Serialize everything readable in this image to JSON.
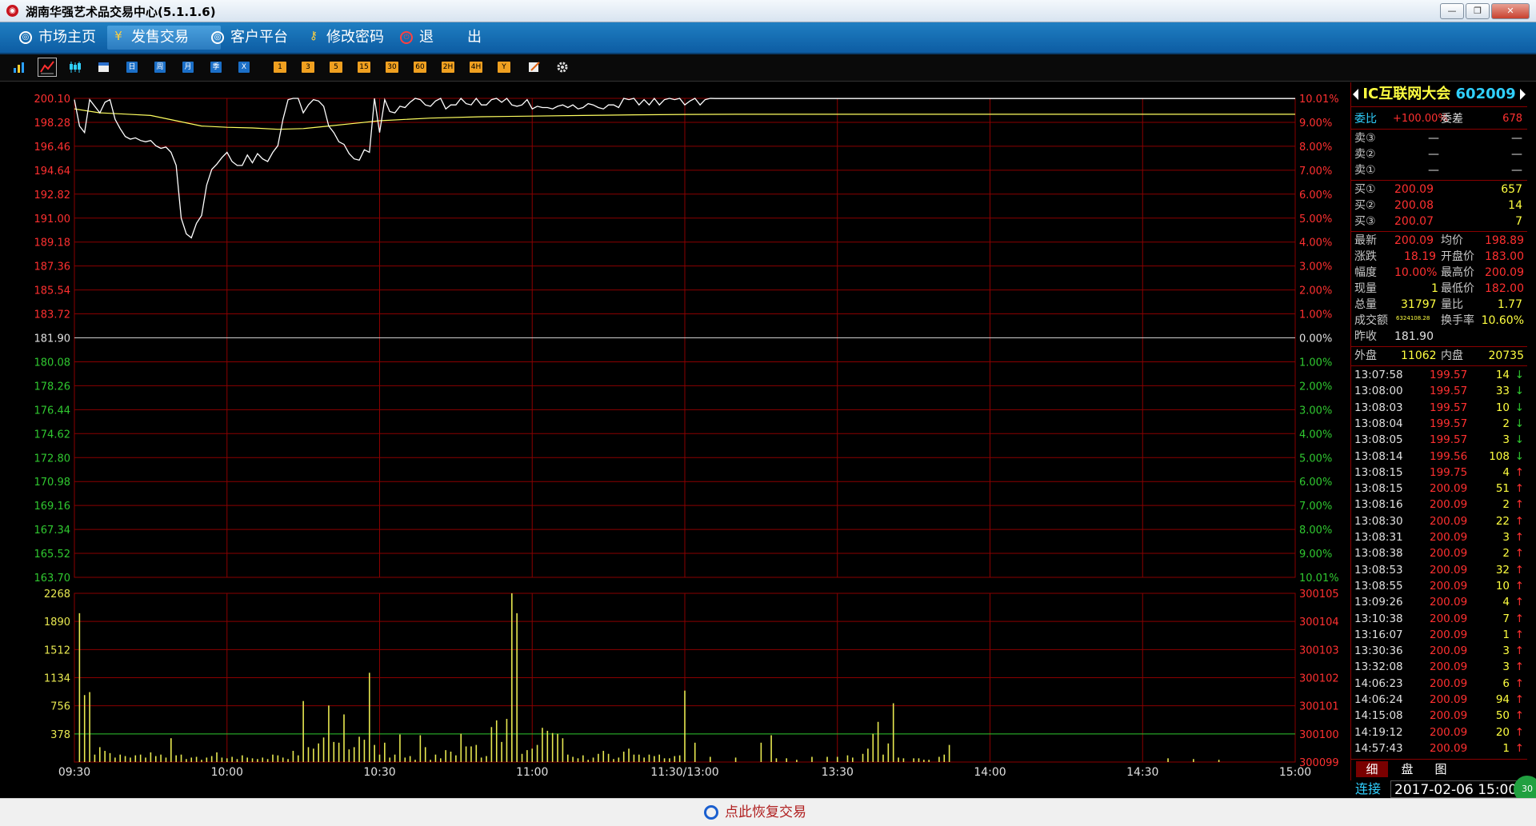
{
  "window": {
    "title": "湖南华强艺术品交易中心(5.1.1.6)",
    "min_glyph": "—",
    "max_glyph": "❐",
    "close_glyph": "✕"
  },
  "menu": [
    {
      "label": "市场主页",
      "icon": "globe-icon"
    },
    {
      "label": "发售交易",
      "icon": "yen-icon"
    },
    {
      "label": "客户平台",
      "icon": "globe-icon"
    },
    {
      "label": "修改密码",
      "icon": "key-icon"
    },
    {
      "label": "退",
      "icon": "power-icon"
    },
    {
      "label": "出",
      "icon": ""
    }
  ],
  "toolbar": {
    "icons": [
      "bar-chart-icon",
      "line-chart-icon",
      "candlestick-icon",
      "calendar-icon"
    ],
    "period_buttons": [
      "日",
      "周",
      "月",
      "季",
      "X"
    ],
    "minute_buttons": [
      "1",
      "3",
      "5",
      "15",
      "30",
      "60",
      "2H",
      "4H",
      "Y"
    ],
    "tool_icons": [
      "draw-icon",
      "gear-icon"
    ]
  },
  "chart_data": {
    "type": "line",
    "price_axis": {
      "left_labels": [
        "200.10",
        "198.28",
        "196.46",
        "194.64",
        "192.82",
        "191.00",
        "189.18",
        "187.36",
        "185.54",
        "183.72",
        "181.90",
        "180.08",
        "178.26",
        "176.44",
        "174.62",
        "172.80",
        "170.98",
        "169.16",
        "167.34",
        "165.52",
        "163.70"
      ],
      "right_labels": [
        "10.01%",
        "9.00%",
        "8.00%",
        "7.00%",
        "6.00%",
        "5.00%",
        "4.00%",
        "3.00%",
        "2.00%",
        "1.00%",
        "0.00%",
        "1.00%",
        "2.00%",
        "3.00%",
        "4.00%",
        "5.00%",
        "6.00%",
        "7.00%",
        "8.00%",
        "9.00%",
        "10.01%"
      ],
      "ylim": [
        163.7,
        200.1
      ],
      "prev_close": 181.9
    },
    "volume_axis": {
      "left_labels": [
        "2268",
        "1890",
        "1512",
        "1134",
        "756",
        "378"
      ],
      "right_labels": [
        "300105",
        "300104",
        "300103",
        "300102",
        "300101",
        "300100",
        "300099"
      ],
      "ylim": [
        0,
        2268
      ]
    },
    "time_labels": [
      "09:30",
      "10:00",
      "10:30",
      "11:00",
      "11:30/13:00",
      "13:30",
      "14:00",
      "14:30",
      "15:00"
    ],
    "x_range_minutes": 240,
    "price_series": [
      [
        0,
        200.0
      ],
      [
        1,
        198.0
      ],
      [
        2,
        197.5
      ],
      [
        3,
        200.0
      ],
      [
        4,
        199.5
      ],
      [
        5,
        199.0
      ],
      [
        6,
        199.8
      ],
      [
        7,
        200.0
      ],
      [
        8,
        198.5
      ],
      [
        9,
        197.8
      ],
      [
        10,
        197.2
      ],
      [
        11,
        197.0
      ],
      [
        12,
        197.1
      ],
      [
        13,
        196.9
      ],
      [
        14,
        196.8
      ],
      [
        15,
        196.9
      ],
      [
        16,
        196.5
      ],
      [
        17,
        196.3
      ],
      [
        18,
        196.4
      ],
      [
        19,
        196.0
      ],
      [
        20,
        195.0
      ],
      [
        21,
        191.0
      ],
      [
        22,
        189.8
      ],
      [
        23,
        189.5
      ],
      [
        24,
        190.6
      ],
      [
        25,
        191.2
      ],
      [
        26,
        193.5
      ],
      [
        27,
        194.7
      ],
      [
        28,
        195.1
      ],
      [
        29,
        195.6
      ],
      [
        30,
        196.0
      ],
      [
        31,
        195.3
      ],
      [
        32,
        195.0
      ],
      [
        33,
        195.0
      ],
      [
        34,
        195.8
      ],
      [
        35,
        195.2
      ],
      [
        36,
        195.9
      ],
      [
        37,
        195.5
      ],
      [
        38,
        195.3
      ],
      [
        39,
        196.0
      ],
      [
        40,
        196.5
      ],
      [
        41,
        198.5
      ],
      [
        42,
        200.0
      ],
      [
        43,
        200.1
      ],
      [
        44,
        200.1
      ],
      [
        45,
        199.0
      ],
      [
        46,
        199.6
      ],
      [
        47,
        200.0
      ],
      [
        48,
        199.9
      ],
      [
        49,
        199.5
      ],
      [
        50,
        198.0
      ],
      [
        51,
        197.5
      ],
      [
        52,
        196.8
      ],
      [
        53,
        196.6
      ],
      [
        54,
        195.9
      ],
      [
        55,
        195.5
      ],
      [
        56,
        195.4
      ],
      [
        57,
        196.2
      ],
      [
        58,
        196.0
      ],
      [
        59,
        200.1
      ],
      [
        60,
        197.5
      ],
      [
        61,
        200.0
      ],
      [
        62,
        199.1
      ],
      [
        63,
        199.0
      ],
      [
        64,
        199.5
      ],
      [
        65,
        199.4
      ],
      [
        66,
        199.8
      ],
      [
        67,
        200.1
      ],
      [
        68,
        200.0
      ],
      [
        69,
        199.6
      ],
      [
        70,
        199.5
      ],
      [
        71,
        199.9
      ],
      [
        72,
        200.1
      ],
      [
        73,
        199.3
      ],
      [
        74,
        199.6
      ],
      [
        75,
        199.6
      ],
      [
        76,
        200.1
      ],
      [
        77,
        199.7
      ],
      [
        78,
        199.6
      ],
      [
        79,
        200.1
      ],
      [
        80,
        199.6
      ],
      [
        81,
        199.6
      ],
      [
        82,
        200.0
      ],
      [
        83,
        200.1
      ],
      [
        84,
        199.8
      ],
      [
        85,
        200.1
      ],
      [
        86,
        199.6
      ],
      [
        87,
        199.5
      ],
      [
        88,
        199.6
      ],
      [
        89,
        200.0
      ],
      [
        90,
        199.3
      ],
      [
        91,
        199.5
      ],
      [
        92,
        199.4
      ],
      [
        93,
        199.4
      ],
      [
        94,
        199.3
      ],
      [
        95,
        199.5
      ],
      [
        96,
        199.6
      ],
      [
        97,
        199.4
      ],
      [
        98,
        199.6
      ],
      [
        99,
        199.3
      ],
      [
        100,
        199.4
      ],
      [
        101,
        199.7
      ],
      [
        102,
        199.6
      ],
      [
        103,
        199.4
      ],
      [
        104,
        199.3
      ],
      [
        105,
        199.6
      ],
      [
        106,
        199.6
      ],
      [
        107,
        199.4
      ],
      [
        108,
        200.1
      ],
      [
        109,
        200.0
      ],
      [
        110,
        200.1
      ],
      [
        111,
        199.6
      ],
      [
        112,
        200.0
      ],
      [
        113,
        199.6
      ],
      [
        114,
        200.1
      ],
      [
        115,
        199.6
      ],
      [
        116,
        200.0
      ],
      [
        117,
        200.1
      ],
      [
        118,
        200.0
      ],
      [
        119,
        200.1
      ],
      [
        120,
        199.6
      ],
      [
        121,
        199.9
      ],
      [
        122,
        200.1
      ],
      [
        123,
        199.6
      ],
      [
        124,
        200.0
      ],
      [
        125,
        200.1
      ],
      [
        126,
        200.09
      ],
      [
        130,
        200.09
      ],
      [
        135,
        200.09
      ],
      [
        240,
        200.09
      ]
    ],
    "avg_series": [
      [
        0,
        199.3
      ],
      [
        5,
        199.0
      ],
      [
        10,
        198.9
      ],
      [
        15,
        198.8
      ],
      [
        20,
        198.4
      ],
      [
        25,
        198.0
      ],
      [
        30,
        197.9
      ],
      [
        35,
        197.85
      ],
      [
        40,
        197.75
      ],
      [
        45,
        197.8
      ],
      [
        50,
        198.0
      ],
      [
        55,
        198.2
      ],
      [
        60,
        198.4
      ],
      [
        70,
        198.6
      ],
      [
        80,
        198.7
      ],
      [
        90,
        198.75
      ],
      [
        100,
        198.8
      ],
      [
        110,
        198.85
      ],
      [
        120,
        198.88
      ],
      [
        130,
        198.89
      ],
      [
        240,
        198.89
      ]
    ],
    "volumes": [
      [
        1,
        2000
      ],
      [
        2,
        900
      ],
      [
        3,
        940
      ],
      [
        4,
        100
      ],
      [
        5,
        200
      ],
      [
        6,
        150
      ],
      [
        7,
        120
      ],
      [
        8,
        60
      ],
      [
        9,
        100
      ],
      [
        10,
        80
      ],
      [
        11,
        60
      ],
      [
        12,
        90
      ],
      [
        13,
        100
      ],
      [
        14,
        60
      ],
      [
        15,
        130
      ],
      [
        16,
        80
      ],
      [
        17,
        100
      ],
      [
        18,
        60
      ],
      [
        19,
        320
      ],
      [
        20,
        90
      ],
      [
        21,
        100
      ],
      [
        22,
        40
      ],
      [
        23,
        60
      ],
      [
        24,
        70
      ],
      [
        25,
        30
      ],
      [
        26,
        60
      ],
      [
        27,
        80
      ],
      [
        28,
        130
      ],
      [
        29,
        60
      ],
      [
        30,
        50
      ],
      [
        31,
        70
      ],
      [
        32,
        40
      ],
      [
        33,
        90
      ],
      [
        34,
        60
      ],
      [
        35,
        50
      ],
      [
        36,
        40
      ],
      [
        37,
        60
      ],
      [
        38,
        40
      ],
      [
        39,
        100
      ],
      [
        40,
        90
      ],
      [
        41,
        60
      ],
      [
        42,
        40
      ],
      [
        43,
        150
      ],
      [
        44,
        90
      ],
      [
        45,
        820
      ],
      [
        46,
        200
      ],
      [
        47,
        180
      ],
      [
        48,
        250
      ],
      [
        49,
        330
      ],
      [
        50,
        760
      ],
      [
        51,
        270
      ],
      [
        52,
        260
      ],
      [
        53,
        640
      ],
      [
        54,
        170
      ],
      [
        55,
        200
      ],
      [
        56,
        340
      ],
      [
        57,
        300
      ],
      [
        58,
        1200
      ],
      [
        59,
        230
      ],
      [
        60,
        100
      ],
      [
        61,
        260
      ],
      [
        62,
        60
      ],
      [
        63,
        100
      ],
      [
        64,
        370
      ],
      [
        65,
        60
      ],
      [
        66,
        80
      ],
      [
        67,
        30
      ],
      [
        68,
        360
      ],
      [
        69,
        200
      ],
      [
        70,
        30
      ],
      [
        71,
        100
      ],
      [
        72,
        50
      ],
      [
        73,
        160
      ],
      [
        74,
        140
      ],
      [
        75,
        90
      ],
      [
        76,
        380
      ],
      [
        77,
        210
      ],
      [
        78,
        210
      ],
      [
        79,
        230
      ],
      [
        80,
        60
      ],
      [
        81,
        80
      ],
      [
        82,
        470
      ],
      [
        83,
        560
      ],
      [
        84,
        270
      ],
      [
        85,
        580
      ],
      [
        86,
        2268
      ],
      [
        87,
        2000
      ],
      [
        88,
        110
      ],
      [
        89,
        160
      ],
      [
        90,
        180
      ],
      [
        91,
        230
      ],
      [
        92,
        460
      ],
      [
        93,
        420
      ],
      [
        94,
        390
      ],
      [
        95,
        380
      ],
      [
        96,
        320
      ],
      [
        97,
        100
      ],
      [
        98,
        70
      ],
      [
        99,
        50
      ],
      [
        100,
        90
      ],
      [
        101,
        30
      ],
      [
        102,
        60
      ],
      [
        103,
        110
      ],
      [
        104,
        150
      ],
      [
        105,
        110
      ],
      [
        106,
        40
      ],
      [
        107,
        60
      ],
      [
        108,
        140
      ],
      [
        109,
        180
      ],
      [
        110,
        100
      ],
      [
        111,
        100
      ],
      [
        112,
        60
      ],
      [
        113,
        100
      ],
      [
        114,
        80
      ],
      [
        115,
        100
      ],
      [
        116,
        50
      ],
      [
        117,
        50
      ],
      [
        118,
        80
      ],
      [
        119,
        90
      ],
      [
        120,
        960
      ],
      [
        122,
        260
      ],
      [
        125,
        70
      ],
      [
        130,
        60
      ],
      [
        135,
        260
      ],
      [
        137,
        360
      ],
      [
        138,
        50
      ],
      [
        140,
        50
      ],
      [
        142,
        30
      ],
      [
        145,
        70
      ],
      [
        148,
        70
      ],
      [
        150,
        70
      ],
      [
        152,
        90
      ],
      [
        153,
        60
      ],
      [
        155,
        110
      ],
      [
        156,
        180
      ],
      [
        157,
        380
      ],
      [
        158,
        540
      ],
      [
        159,
        100
      ],
      [
        160,
        250
      ],
      [
        161,
        790
      ],
      [
        162,
        60
      ],
      [
        163,
        50
      ],
      [
        165,
        50
      ],
      [
        166,
        50
      ],
      [
        167,
        30
      ],
      [
        168,
        30
      ],
      [
        170,
        70
      ],
      [
        171,
        100
      ],
      [
        172,
        230
      ],
      [
        215,
        50
      ],
      [
        220,
        40
      ],
      [
        225,
        30
      ]
    ]
  },
  "quote": {
    "name": "IC互联网大会",
    "code": "602009",
    "weibi_label": "委比",
    "weibi_value": "+100.00%",
    "weicha_label": "委差",
    "weicha_value": "678",
    "asks": [
      {
        "label": "卖③",
        "price": "—",
        "vol": "—"
      },
      {
        "label": "卖②",
        "price": "—",
        "vol": "—"
      },
      {
        "label": "卖①",
        "price": "—",
        "vol": "—"
      }
    ],
    "bids": [
      {
        "label": "买①",
        "price": "200.09",
        "vol": "657"
      },
      {
        "label": "买②",
        "price": "200.08",
        "vol": "14"
      },
      {
        "label": "买③",
        "price": "200.07",
        "vol": "7"
      }
    ],
    "latest_label": "最新",
    "latest_value": "200.09",
    "avg_label": "均价",
    "avg_value": "198.89",
    "change_label": "涨跌",
    "change_value": "18.19",
    "open_label": "开盘价",
    "open_value": "183.00",
    "pct_label": "幅度",
    "pct_value": "10.00%",
    "high_label": "最高价",
    "high_value": "200.09",
    "cur_label": "现量",
    "cur_value": "1",
    "low_label": "最低价",
    "low_value": "182.00",
    "total_label": "总量",
    "total_value": "31797",
    "ratio_label": "量比",
    "ratio_value": "1.77",
    "amount_label": "成交额",
    "amount_value": "6324108.28",
    "turnover_label": "换手率",
    "turnover_value": "10.60%",
    "prev_label": "昨收",
    "prev_value": "181.90",
    "outer_label": "外盘",
    "outer_value": "11062",
    "inner_label": "内盘",
    "inner_value": "20735"
  },
  "ticks": [
    {
      "time": "13:07:58",
      "price": "199.57",
      "vol": "14",
      "dir": "down"
    },
    {
      "time": "13:08:00",
      "price": "199.57",
      "vol": "33",
      "dir": "down"
    },
    {
      "time": "13:08:03",
      "price": "199.57",
      "vol": "10",
      "dir": "down"
    },
    {
      "time": "13:08:04",
      "price": "199.57",
      "vol": "2",
      "dir": "down"
    },
    {
      "time": "13:08:05",
      "price": "199.57",
      "vol": "3",
      "dir": "down"
    },
    {
      "time": "13:08:14",
      "price": "199.56",
      "vol": "108",
      "dir": "down"
    },
    {
      "time": "13:08:15",
      "price": "199.75",
      "vol": "4",
      "dir": "up"
    },
    {
      "time": "13:08:15",
      "price": "200.09",
      "vol": "51",
      "dir": "up"
    },
    {
      "time": "13:08:16",
      "price": "200.09",
      "vol": "2",
      "dir": "up"
    },
    {
      "time": "13:08:30",
      "price": "200.09",
      "vol": "22",
      "dir": "up"
    },
    {
      "time": "13:08:31",
      "price": "200.09",
      "vol": "3",
      "dir": "up"
    },
    {
      "time": "13:08:38",
      "price": "200.09",
      "vol": "2",
      "dir": "up"
    },
    {
      "time": "13:08:53",
      "price": "200.09",
      "vol": "32",
      "dir": "up"
    },
    {
      "time": "13:08:55",
      "price": "200.09",
      "vol": "10",
      "dir": "up"
    },
    {
      "time": "13:09:26",
      "price": "200.09",
      "vol": "4",
      "dir": "up"
    },
    {
      "time": "13:10:38",
      "price": "200.09",
      "vol": "7",
      "dir": "up"
    },
    {
      "time": "13:16:07",
      "price": "200.09",
      "vol": "1",
      "dir": "up"
    },
    {
      "time": "13:30:36",
      "price": "200.09",
      "vol": "3",
      "dir": "up"
    },
    {
      "time": "13:32:08",
      "price": "200.09",
      "vol": "3",
      "dir": "up"
    },
    {
      "time": "14:06:23",
      "price": "200.09",
      "vol": "6",
      "dir": "up"
    },
    {
      "time": "14:06:24",
      "price": "200.09",
      "vol": "94",
      "dir": "up"
    },
    {
      "time": "14:15:08",
      "price": "200.09",
      "vol": "50",
      "dir": "up"
    },
    {
      "time": "14:19:12",
      "price": "200.09",
      "vol": "20",
      "dir": "up"
    },
    {
      "time": "14:57:43",
      "price": "200.09",
      "vol": "1",
      "dir": "up"
    }
  ],
  "bottom_tabs": [
    "细",
    "盘",
    "图"
  ],
  "status": {
    "connection": "连接",
    "datetime": "2017-02-06 15:00",
    "badge": "30"
  },
  "footer": {
    "restore_label": "点此恢复交易"
  },
  "colors": {
    "grid": "#8a0000",
    "price_line": "#ffffff",
    "avg_line": "#ffff60",
    "volume_bar": "#e8e850",
    "up": "#ff3030",
    "down": "#30c830",
    "menu_bg": "#0d5ca3"
  }
}
